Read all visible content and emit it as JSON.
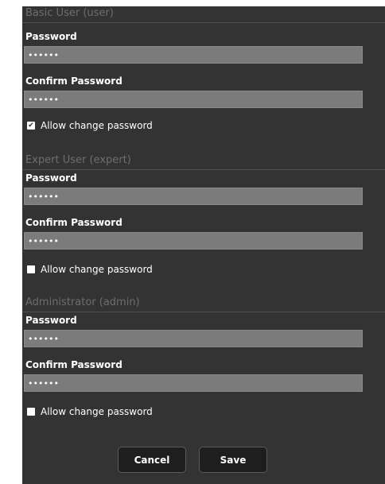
{
  "sections": [
    {
      "title": "Basic User (user)",
      "password_label": "Password",
      "password_value": "••••••",
      "confirm_label": "Confirm Password",
      "confirm_value": "••••••",
      "allow_label": "Allow change password",
      "allow_checked": true
    },
    {
      "title": "Expert User (expert)",
      "password_label": "Password",
      "password_value": "••••••",
      "confirm_label": "Confirm Password",
      "confirm_value": "••••••",
      "allow_label": "Allow change password",
      "allow_checked": false
    },
    {
      "title": "Administrator (admin)",
      "password_label": "Password",
      "password_value": "••••••",
      "confirm_label": "Confirm Password",
      "confirm_value": "••••••",
      "allow_label": "Allow change password",
      "allow_checked": false
    }
  ],
  "buttons": {
    "cancel": "Cancel",
    "save": "Save"
  },
  "icons": {
    "checkmark": "checkmark-icon"
  },
  "colors": {
    "panel_bg": "#333333",
    "input_bg": "#7b7b7b",
    "header_text": "#6e6e6e",
    "button_bg": "#1e1e1e"
  }
}
